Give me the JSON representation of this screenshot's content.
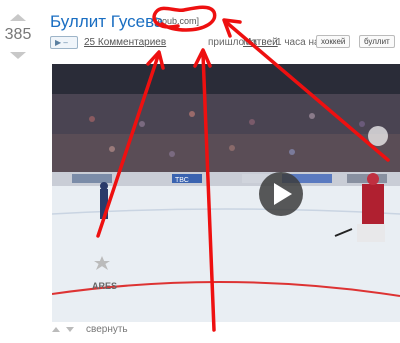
{
  "vote": {
    "score": "385"
  },
  "post": {
    "title": "Буллит Гусева",
    "domain": "[coub.com]",
    "media_badge": "▶ –",
    "comments": "25 Комментариев",
    "from_label": "пришло от",
    "author": "Матвей",
    "time": "1 часа назад",
    "tags": [
      "хоккей",
      "буллит"
    ]
  },
  "video": {
    "ticker": "ТВС",
    "brand": "ARES"
  },
  "footer": {
    "collapse": "свернуть"
  },
  "colors": {
    "link": "#1a6ec2",
    "annotation": "#ee1010",
    "ice": "#e9eef3"
  }
}
